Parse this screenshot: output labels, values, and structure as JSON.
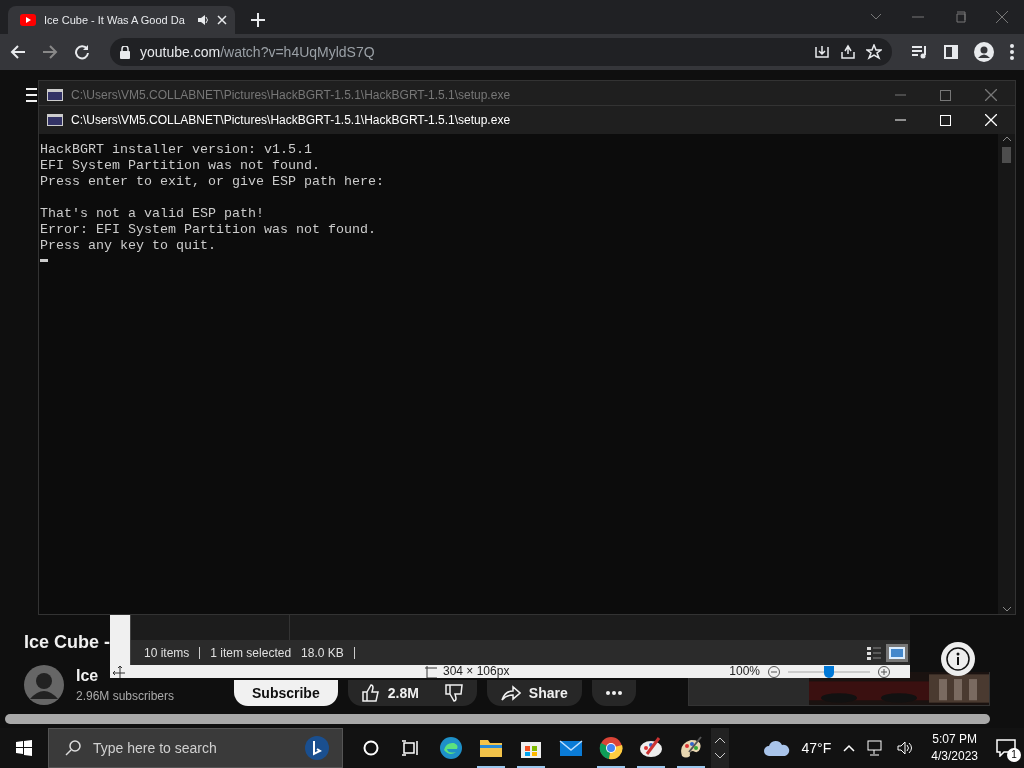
{
  "browser": {
    "tab": {
      "title": "Ice Cube - It Was A Good Da",
      "selected": true,
      "audible": true
    },
    "address": {
      "host": "youtube.com",
      "path": "/watch?v=h4UqMyldS7Q"
    }
  },
  "video_page": {
    "title": "Ice Cube -",
    "channel": "Ice",
    "subscribers": "2.96M subscribers",
    "subscribe": "Subscribe",
    "likes": "2.8M",
    "share": "Share"
  },
  "windows": [
    {
      "title": "C:\\Users\\VM5.COLLABNET\\Pictures\\HackBGRT-1.5.1\\HackBGRT-1.5.1\\setup.exe",
      "active": false
    },
    {
      "title": "C:\\Users\\VM5.COLLABNET\\Pictures\\HackBGRT-1.5.1\\HackBGRT-1.5.1\\setup.exe",
      "active": true,
      "console": [
        [
          "HackBGRT installer version: v1.5.1",
          "EFI System Partition was not found.",
          "Press enter to exit, or give ESP path here:"
        ],
        [
          "That's not a valid ESP path!",
          "Error: EFI System Partition was not found.",
          "Press any key to quit."
        ]
      ]
    }
  ],
  "explorer_status": {
    "items": "10 items",
    "selection": "1 item selected",
    "size": "18.0 KB"
  },
  "paint_status": {
    "image_size": "304 × 106px",
    "zoom": "100%",
    "zoom_slider": {
      "level": 0.5
    }
  },
  "taskbar": {
    "search_placeholder": "Type here to search",
    "apps": [
      {
        "kind": "edge",
        "running": false
      },
      {
        "kind": "folder",
        "running": true
      },
      {
        "kind": "store",
        "running": true
      },
      {
        "kind": "mail",
        "running": false
      },
      {
        "kind": "chrome",
        "running": true
      },
      {
        "kind": "paint",
        "running": true
      },
      {
        "kind": "paint3d",
        "running": true
      }
    ],
    "weather": "47°F",
    "time": "5:07 PM",
    "date": "4/3/2023",
    "notifications": "1"
  }
}
